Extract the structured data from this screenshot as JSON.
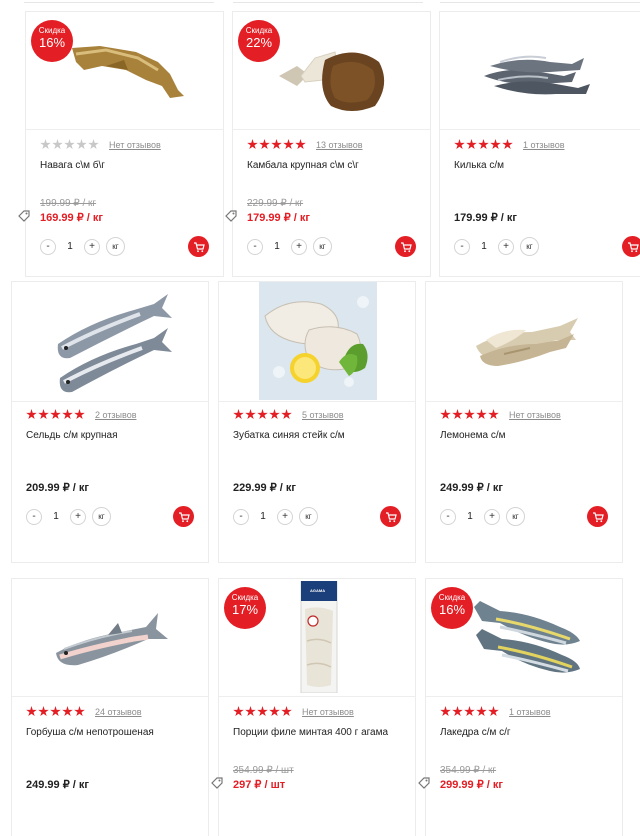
{
  "labels": {
    "discount": "Скидка",
    "qty_minus": "-",
    "qty_plus": "+",
    "qty_value": "1",
    "unit_kg": "кг"
  },
  "products": [
    {
      "title": "Навага с\\м б\\г",
      "rating": 0,
      "reviews": "Нет отзывов",
      "old_price": "199.99 ₽ / кг",
      "price": "169.99 ₽ / кг",
      "discount": "16%",
      "image": "navaga"
    },
    {
      "title": "Камбала крупная с\\м с\\г",
      "rating": 5,
      "reviews": "13 отзывов",
      "old_price": "229.99 ₽ / кг",
      "price": "179.99 ₽ / кг",
      "discount": "22%",
      "image": "kambala"
    },
    {
      "title": "Килька с/м",
      "rating": 5,
      "reviews": "1 отзывов",
      "price": "179.99 ₽ / кг",
      "image": "kilka"
    },
    {
      "title": "Сельдь с/м крупная",
      "rating": 5,
      "reviews": "2 отзывов",
      "price": "209.99 ₽ / кг",
      "image": "seld"
    },
    {
      "title": "Зубатка синяя стейк с/м",
      "rating": 5,
      "reviews": "5 отзывов",
      "price": "229.99 ₽ / кг",
      "image": "zubatka"
    },
    {
      "title": "Лемонема с/м",
      "rating": 5,
      "reviews": "Нет отзывов",
      "price": "249.99 ₽ / кг",
      "image": "lemonema"
    },
    {
      "title": "Горбуша с/м непотрошеная",
      "rating": 5,
      "reviews": "24 отзывов",
      "price": "249.99 ₽ / кг",
      "image": "gorbusha"
    },
    {
      "title": "Порции филе минтая 400 г агама",
      "rating": 5,
      "reviews": "Нет отзывов",
      "old_price": "354.99 ₽ / шт",
      "price": "297 ₽ / шт",
      "discount": "17%",
      "image": "mintay",
      "package_brand": "AGAMA"
    },
    {
      "title": "Лакедра с/м с/г",
      "rating": 5,
      "reviews": "1 отзывов",
      "old_price": "354.99 ₽ / кг",
      "price": "299.99 ₽ / кг",
      "discount": "16%",
      "image": "lakedra"
    }
  ]
}
